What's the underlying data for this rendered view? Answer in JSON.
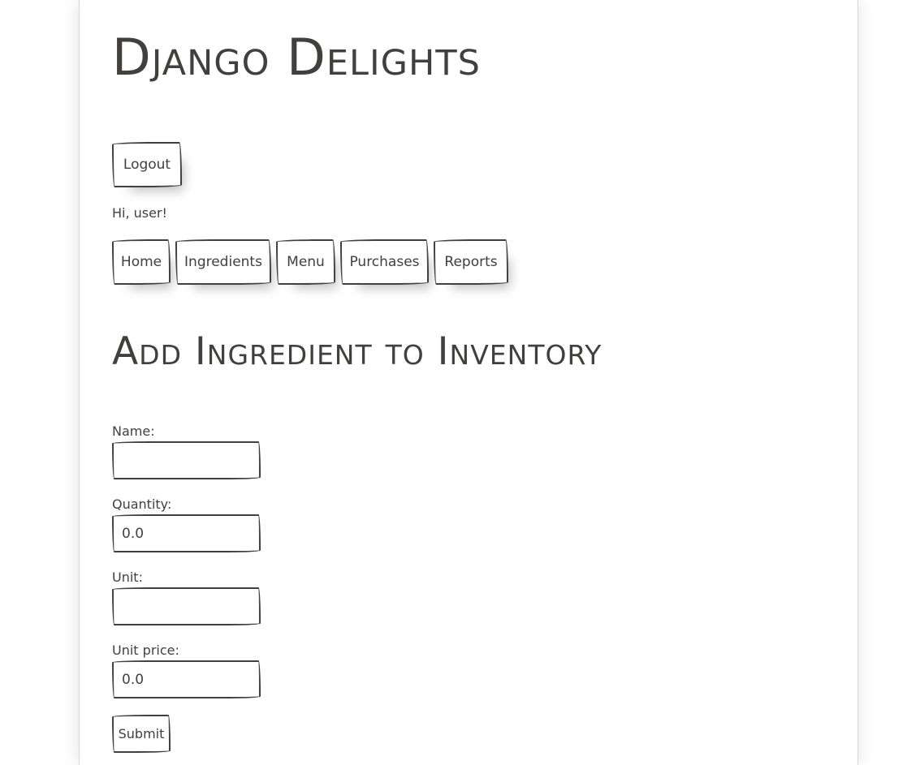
{
  "site": {
    "title": "Django Delights"
  },
  "auth": {
    "logout_label": "Logout",
    "greeting": "Hi, user!"
  },
  "nav": {
    "items": [
      {
        "label": "Home"
      },
      {
        "label": "Ingredients"
      },
      {
        "label": "Menu"
      },
      {
        "label": "Purchases"
      },
      {
        "label": "Reports"
      }
    ]
  },
  "form": {
    "title": "Add Ingredient to Inventory",
    "fields": [
      {
        "label": "Name:",
        "value": ""
      },
      {
        "label": "Quantity:",
        "value": "0.0"
      },
      {
        "label": "Unit:",
        "value": ""
      },
      {
        "label": "Unit price:",
        "value": "0.0"
      }
    ],
    "submit_label": "Submit"
  },
  "colors": {
    "text": "#41403e",
    "border": "#41403e",
    "background": "#ffffff"
  }
}
